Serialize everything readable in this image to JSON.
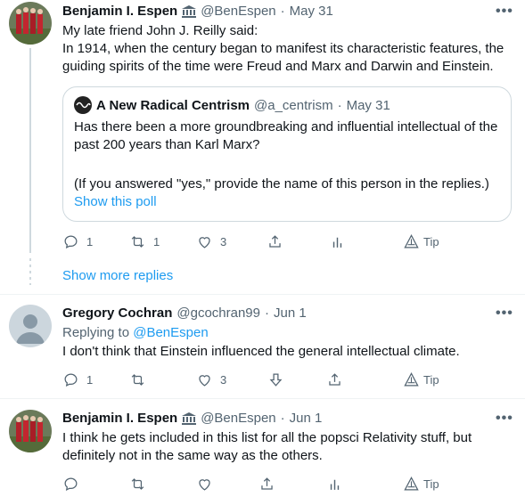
{
  "tweet1": {
    "author_name": "Benjamin I. Espen",
    "badge": "museum-icon",
    "handle": "@BenEspen",
    "sep": "·",
    "date": "May 31",
    "text_lines": [
      "My late friend John J. Reilly said:",
      "In 1914, when the century began to manifest its characteristic features, the",
      "guiding spirits of the time were Freud and Marx and Darwin and Einstein."
    ],
    "quote": {
      "author_name": "A New Radical Centrism",
      "handle": "@a_centrism",
      "sep": "·",
      "date": "May 31",
      "text_lines": [
        "Has there been a more groundbreaking and influential intellectual of the",
        "past 200 years than Karl Marx?",
        "",
        "(If you answered \"yes,\" provide the name of this person in the replies.)"
      ],
      "poll_link": "Show this poll"
    },
    "reply_count": "1",
    "retweet_count": "1",
    "like_count": "3",
    "tip_label": "Tip"
  },
  "show_more_replies": "Show more replies",
  "tweet2": {
    "author_name": "Gregory Cochran",
    "handle": "@gcochran99",
    "sep": "·",
    "date": "Jun 1",
    "replying_prefix": "Replying to ",
    "replying_handle": "@BenEspen",
    "text_lines": [
      "I don't think that Einstein influenced the general intellectual climate."
    ],
    "reply_count": "1",
    "like_count": "3",
    "tip_label": "Tip"
  },
  "tweet3": {
    "author_name": "Benjamin I. Espen",
    "badge": "museum-icon",
    "handle": "@BenEspen",
    "sep": "·",
    "date": "Jun 1",
    "text_lines": [
      "I think he gets included in this list for all the popsci Relativity stuff, but",
      "definitely not in the same way as the others."
    ],
    "tip_label": "Tip"
  },
  "more_label": "•••",
  "colors": {
    "accent": "#1d9bf0",
    "muted": "#536471",
    "border": "#cfd9de"
  }
}
